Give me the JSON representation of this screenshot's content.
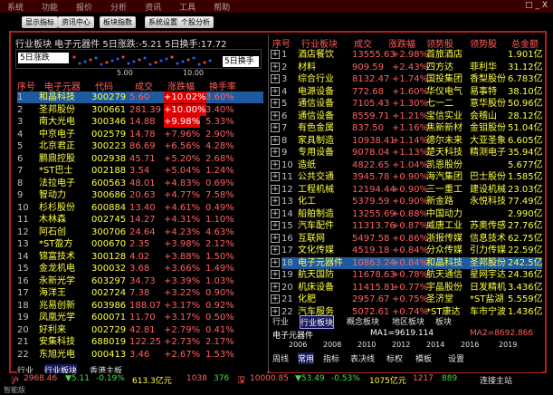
{
  "titlebar": {
    "menu": [
      "系统",
      "功能",
      "报价",
      "分析",
      "资讯",
      "工具",
      "帮助"
    ],
    "controls": "□ _ X"
  },
  "toolbar": {
    "buttons": [
      "显示指标",
      "资讯中心",
      "板块指数",
      "系统设置",
      "个股分析"
    ]
  },
  "left_panel": {
    "title": "行业板块  电子元器件  5日涨跌:-5.21  5日换手:17.72",
    "mini_left": "5日涨跌",
    "mini_right": "5日换手",
    "axis": [
      "5.00",
      "10.00"
    ],
    "headers": [
      "序号",
      "电子元器",
      "代码",
      "成交",
      "涨跌幅",
      "换手率"
    ],
    "rows": [
      {
        "idx": "1",
        "name": "和晶科技",
        "code": "300279",
        "price": "5.60",
        "chg": "+10.02%",
        "turn": "3.60%",
        "sel": true,
        "limit": true
      },
      {
        "idx": "2",
        "name": "圣邦股份",
        "code": "300661",
        "price": "281.39",
        "chg": "+10.00%",
        "turn": "3.40%",
        "sel": false,
        "limit": true
      },
      {
        "idx": "3",
        "name": "南大光电",
        "code": "300346",
        "price": "14.88",
        "chg": "+9.98%",
        "turn": "5.33%",
        "sel": false,
        "limit": true
      },
      {
        "idx": "4",
        "name": "中京电子",
        "code": "002579",
        "price": "14.78",
        "chg": "+7.96%",
        "turn": "2.90%",
        "sel": false,
        "limit": false
      },
      {
        "idx": "5",
        "name": "北京君正",
        "code": "300223",
        "price": "86.69",
        "chg": "+6.56%",
        "turn": "4.28%",
        "sel": false,
        "limit": false
      },
      {
        "idx": "6",
        "name": "鹏鼎控股",
        "code": "002938",
        "price": "45.71",
        "chg": "+5.20%",
        "turn": "2.68%",
        "sel": false,
        "limit": false
      },
      {
        "idx": "7",
        "name": "*ST巴士",
        "code": "002188",
        "price": "3.54",
        "chg": "+5.04%",
        "turn": "1.24%",
        "sel": false,
        "limit": false
      },
      {
        "idx": "8",
        "name": "法拉电子",
        "code": "600563",
        "price": "48.01",
        "chg": "+4.83%",
        "turn": "0.69%",
        "sel": false,
        "limit": false
      },
      {
        "idx": "9",
        "name": "智动力",
        "code": "300686",
        "price": "20.63",
        "chg": "+4.77%",
        "turn": "7.58%",
        "sel": false,
        "limit": false
      },
      {
        "idx": "10",
        "name": "杉杉股份",
        "code": "600884",
        "price": "13.40",
        "chg": "+4.61%",
        "turn": "0.49%",
        "sel": false,
        "limit": false
      },
      {
        "idx": "11",
        "name": "木林森",
        "code": "002745",
        "price": "14.27",
        "chg": "+4.31%",
        "turn": "1.10%",
        "sel": false,
        "limit": false
      },
      {
        "idx": "12",
        "name": "阿石创",
        "code": "300706",
        "price": "24.64",
        "chg": "+4.23%",
        "turn": "4.63%",
        "sel": false,
        "limit": false
      },
      {
        "idx": "13",
        "name": "*ST盈方",
        "code": "000670",
        "price": "2.35",
        "chg": "+3.98%",
        "turn": "2.12%",
        "sel": false,
        "limit": false
      },
      {
        "idx": "14",
        "name": "锦富技术",
        "code": "300128",
        "price": "4.02",
        "chg": "+3.88%",
        "turn": "1.50%",
        "sel": false,
        "limit": false
      },
      {
        "idx": "15",
        "name": "金龙机电",
        "code": "300032",
        "price": "3.68",
        "chg": "+3.66%",
        "turn": "1.49%",
        "sel": false,
        "limit": false
      },
      {
        "idx": "16",
        "name": "永新光学",
        "code": "603297",
        "price": "34.73",
        "chg": "+3.39%",
        "turn": "1.03%",
        "sel": false,
        "limit": false
      },
      {
        "idx": "17",
        "name": "海洋王",
        "code": "002724",
        "price": "7.38",
        "chg": "+3.22%",
        "turn": "0.90%",
        "sel": false,
        "limit": false
      },
      {
        "idx": "18",
        "name": "兆易创新",
        "code": "603986",
        "price": "188.07",
        "chg": "+3.17%",
        "turn": "0.92%",
        "sel": false,
        "limit": false
      },
      {
        "idx": "19",
        "name": "凤凰光学",
        "code": "600071",
        "price": "11.70",
        "chg": "+3.17%",
        "turn": "0.50%",
        "sel": false,
        "limit": false
      },
      {
        "idx": "20",
        "name": "好利来",
        "code": "002729",
        "price": "42.81",
        "chg": "+2.79%",
        "turn": "0.41%",
        "sel": false,
        "limit": false
      },
      {
        "idx": "21",
        "name": "安集科技",
        "code": "688019",
        "price": "122.25",
        "chg": "+2.73%",
        "turn": "2.17%",
        "sel": false,
        "limit": false
      },
      {
        "idx": "22",
        "name": "东旭光电",
        "code": "000413",
        "price": "3.46",
        "chg": "+2.67%",
        "turn": "1.53%",
        "sel": false,
        "limit": false
      }
    ],
    "tabs": [
      "行业",
      "行业板块",
      "香港主板"
    ]
  },
  "right_panel": {
    "headers": [
      "序号",
      "行业板块",
      "成交",
      "涨跌幅",
      "领势股",
      "领势股",
      "总金额"
    ],
    "rows": [
      {
        "idx": "1",
        "name": "酒店餐饮",
        "vol": "13555.63",
        "chg": "+2.98%",
        "lead1": "首旅酒店",
        "lead2": "",
        "amt": "1.901亿"
      },
      {
        "idx": "2",
        "name": "材料",
        "vol": "909.59",
        "chg": "+2.43%",
        "lead1": "四方达",
        "lead2": "菲利华",
        "amt": "31.12亿"
      },
      {
        "idx": "3",
        "name": "综合行业",
        "vol": "8132.47",
        "chg": "+1.74%",
        "lead1": "国投集团",
        "lead2": "香梨股份",
        "amt": "6.783亿"
      },
      {
        "idx": "4",
        "name": "电源设备",
        "vol": "772.68",
        "chg": "+1.60%",
        "lead1": "华仪电气",
        "lead2": "易事特",
        "amt": "38.10亿"
      },
      {
        "idx": "5",
        "name": "通信设备",
        "vol": "7105.43",
        "chg": "+1.30%",
        "lead1": "七一二",
        "lead2": "意华股份",
        "amt": "50.96亿"
      },
      {
        "idx": "6",
        "name": "通信设备",
        "vol": "8559.71",
        "chg": "+1.21%",
        "lead1": "宝信实业",
        "lead2": "会稽山",
        "amt": "28.12亿"
      },
      {
        "idx": "7",
        "name": "有色金属",
        "vol": "837.50",
        "chg": "+1.16%",
        "lead1": "焦新新材",
        "lead2": "金钼股份",
        "amt": "51.04亿"
      },
      {
        "idx": "8",
        "name": "家具制造",
        "vol": "10938.41",
        "chg": "+1.14%",
        "lead1": "德尔未来",
        "lead2": "大亚圣象",
        "amt": "6.605亿"
      },
      {
        "idx": "9",
        "name": "专用设备",
        "vol": "9078.04",
        "chg": "+1.13%",
        "lead1": "楚天科技",
        "lead2": "精测电子",
        "amt": "35.94亿"
      },
      {
        "idx": "10",
        "name": "造纸",
        "vol": "4822.65",
        "chg": "+1.04%",
        "lead1": "凯恩股份",
        "lead2": "",
        "amt": "5.677亿"
      },
      {
        "idx": "11",
        "name": "公共交通",
        "vol": "3945.78",
        "chg": "+0.90%",
        "lead1": "海汽集团",
        "lead2": "巴士股份",
        "amt": "1.585亿"
      },
      {
        "idx": "12",
        "name": "工程机械",
        "vol": "12194.44",
        "chg": "+0.90%",
        "lead1": "三一重工",
        "lead2": "建设机械",
        "amt": "23.03亿"
      },
      {
        "idx": "13",
        "name": "化工",
        "vol": "5379.59",
        "chg": "+0.90%",
        "lead1": "新金路",
        "lead2": "永悦科技",
        "amt": "77.49亿"
      },
      {
        "idx": "14",
        "name": "船舶制造",
        "vol": "13255.69",
        "chg": "+0.88%",
        "lead1": "中国动力",
        "lead2": "",
        "amt": "2.990亿"
      },
      {
        "idx": "15",
        "name": "汽车配件",
        "vol": "11313.76",
        "chg": "+0.87%",
        "lead1": "威唐工业",
        "lead2": "苏奥传感",
        "amt": "27.76亿"
      },
      {
        "idx": "16",
        "name": "互联网",
        "vol": "5497.58",
        "chg": "+0.86%",
        "lead1": "浙报传媒",
        "lead2": "信息技术",
        "amt": "62.75亿"
      },
      {
        "idx": "17",
        "name": "文化传媒",
        "vol": "4519.18",
        "chg": "+0.84%",
        "lead1": "分众传媒",
        "lead2": "引力传媒",
        "amt": "22.59亿"
      },
      {
        "idx": "18",
        "name": "电子元器件",
        "vol": "10863.24",
        "chg": "+0.84%",
        "lead1": "和晶科技",
        "lead2": "圣邦股份",
        "amt": "242.5亿",
        "sel": true
      },
      {
        "idx": "19",
        "name": "航天国防",
        "vol": "11678.63",
        "chg": "+0.78%",
        "lead1": "航天通信",
        "lead2": "星网宇达",
        "amt": "24.36亿"
      },
      {
        "idx": "20",
        "name": "机床设备",
        "vol": "11415.81",
        "chg": "+0.77%",
        "lead1": "宇晶股份",
        "lead2": "日发精机",
        "amt": "3.436亿"
      },
      {
        "idx": "21",
        "name": "化肥",
        "vol": "2957.67",
        "chg": "+0.75%",
        "lead1": "圣济堂",
        "lead2": "*ST盐湖",
        "amt": "5.559亿"
      },
      {
        "idx": "22",
        "name": "汽车服务",
        "vol": "5072.61",
        "chg": "+0.74%",
        "lead1": "*ST康达",
        "lead2": "车市宁波",
        "amt": "1.436亿"
      }
    ],
    "tabs": [
      "行业",
      "行业板块",
      "概念板块",
      "地区板块",
      "板块"
    ],
    "mini_title": "电子元器件",
    "ma1": "MA1=9619.114",
    "ma2": "MA2=8692.866",
    "timeline": [
      "2006",
      "2008",
      "2010",
      "2012",
      "2014",
      "2016",
      "2019"
    ],
    "periods": [
      "周线",
      "常用",
      "指标",
      "表决线",
      "标权",
      "模板",
      "设置"
    ]
  },
  "bottombar": {
    "index": "沪",
    "value": "2968.46",
    "change": "▼5.11",
    "pct": "-0.19%",
    "amount": "613.3亿元",
    "num1": "1038",
    "num2": "376",
    "dot": "深",
    "val2": "10000.85",
    "chg2": "▼53.49",
    "pct2": "-0.53%",
    "amt2": "1075亿元",
    "n3": "1217",
    "n4": "889",
    "conn": "连接主站"
  },
  "statusbar": {
    "brand": "智能版",
    "items": [
      "沪",
      "2968.46",
      "▼5.11",
      "-0.19%",
      "613.3亿元",
      "1038",
      "376",
      "深",
      "10000.85",
      "▼53.49",
      "-0.53%",
      "1075亿元",
      "1217",
      "889",
      "连接主站"
    ]
  }
}
